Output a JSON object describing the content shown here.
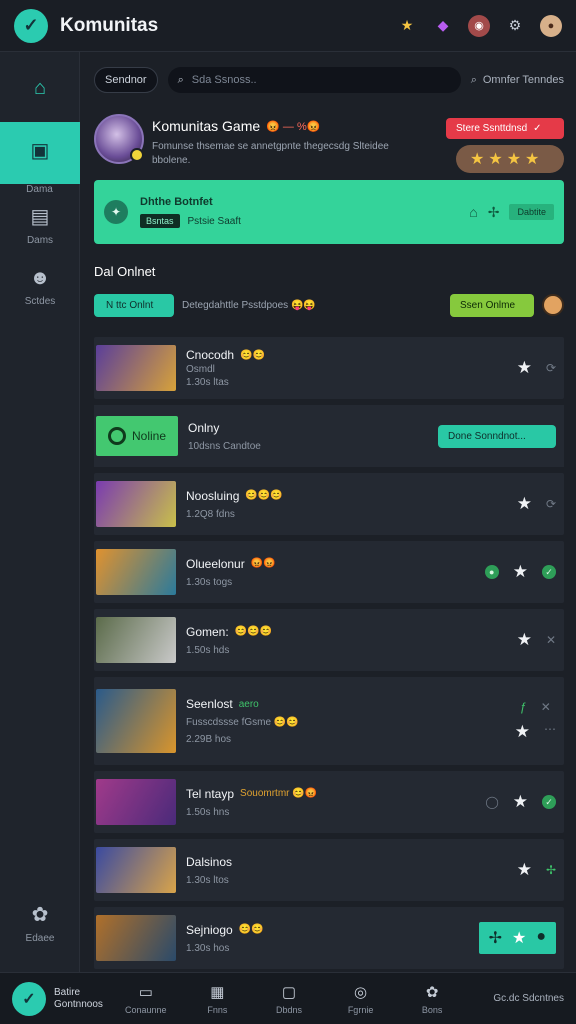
{
  "app": {
    "title": "Komunitas"
  },
  "topbar_icons": [
    "star-icon",
    "gem-icon",
    "mascot-icon",
    "settings-icon",
    "profile-icon"
  ],
  "sidebar": {
    "items": [
      {
        "icon": "home-icon",
        "label": ""
      },
      {
        "icon": "store-icon",
        "label": "Dama",
        "active": true
      },
      {
        "icon": "list-icon",
        "label": "Dams"
      },
      {
        "icon": "group-icon",
        "label": "Sctdes"
      }
    ],
    "bottom": {
      "icon": "cluster-icon",
      "label": "Edaee"
    }
  },
  "search": {
    "filter_label": "Sendnor",
    "placeholder": "Sda Ssnoss..",
    "sort_label": "Omnfer  Tenndes"
  },
  "header": {
    "title": "Komunitas Game",
    "title_emoji": "😡 — %😡",
    "desc": "Fomunse thsemae se annetgpnte thegecsdg Slteidee bbolene.",
    "cta_label": "Stere Ssnttdnsd",
    "rating": "★★★★"
  },
  "banner": {
    "title": "Dhthe Botnfet",
    "tag": "Bsntas",
    "sub": "Pstsie Saaft",
    "small": "Dabtite"
  },
  "online": {
    "section_label": "Dal Onlnet",
    "button": "N ttc Onlnt",
    "desc": "Detegdahttle Psstdpoes 😝😝",
    "right_button": "Ssen Onlme"
  },
  "games": [
    {
      "name": "Cnocodh",
      "emoji": "😊😊",
      "sub1": "Osmdl",
      "sub2": "1.30s ltas",
      "thumb": [
        "#5a3e9a",
        "#d7a23a"
      ]
    },
    {
      "special": true,
      "name": "Onlny",
      "sub": "10dsns Candtoe",
      "thumb_label": "Noline",
      "button": "Done Sonndnot..."
    },
    {
      "name": "Noosluing",
      "emoji": "😊😊😊",
      "sub": "1.2Q8 fdns",
      "thumb": [
        "#7a3bb0",
        "#c9c04a"
      ]
    },
    {
      "name": "Olueelonur",
      "emoji": "😡😡",
      "sub": "1.30s togs",
      "thumb": [
        "#e0922f",
        "#2b7a9b"
      ]
    },
    {
      "name": "Gomen:",
      "emoji": "😊😊😊",
      "sub": "1.50s hds",
      "thumb": [
        "#5b6b4a",
        "#c9c9c9"
      ]
    },
    {
      "name": "Seenlost",
      "emoji": "aero",
      "sub": "Fusscdssse fGsme 😊😊",
      "sub2": "2.29B hos",
      "thumb": [
        "#2a5a8a",
        "#d9952c"
      ],
      "tall": true
    },
    {
      "name": "Tel ntayp",
      "emoji": "Souomrtmr 😊😡",
      "sub": "1.50s hns",
      "thumb": [
        "#a03a8a",
        "#4a2a7a"
      ]
    },
    {
      "name": "Dalsinos",
      "emoji": "",
      "sub": "1.30s ltos",
      "thumb": [
        "#3a4aa0",
        "#d9a44a"
      ]
    },
    {
      "name": "Sejniogo",
      "emoji": "😊😊",
      "sub": "1.30s hos",
      "thumb": [
        "#b0702a",
        "#2a4a6a"
      ],
      "last": true
    }
  ],
  "bottomnav": {
    "brand": "Batire Gontnnoos",
    "items": [
      {
        "icon": "chat-icon",
        "label": "Conaunne"
      },
      {
        "icon": "gift-icon",
        "label": "Fnns"
      },
      {
        "icon": "card-icon",
        "label": "Dbdns"
      },
      {
        "icon": "trophy-icon",
        "label": "Fgrnie"
      },
      {
        "icon": "gamepad-icon",
        "label": "Bons"
      }
    ],
    "right_label": "Gc.dc Sdcntnes"
  }
}
